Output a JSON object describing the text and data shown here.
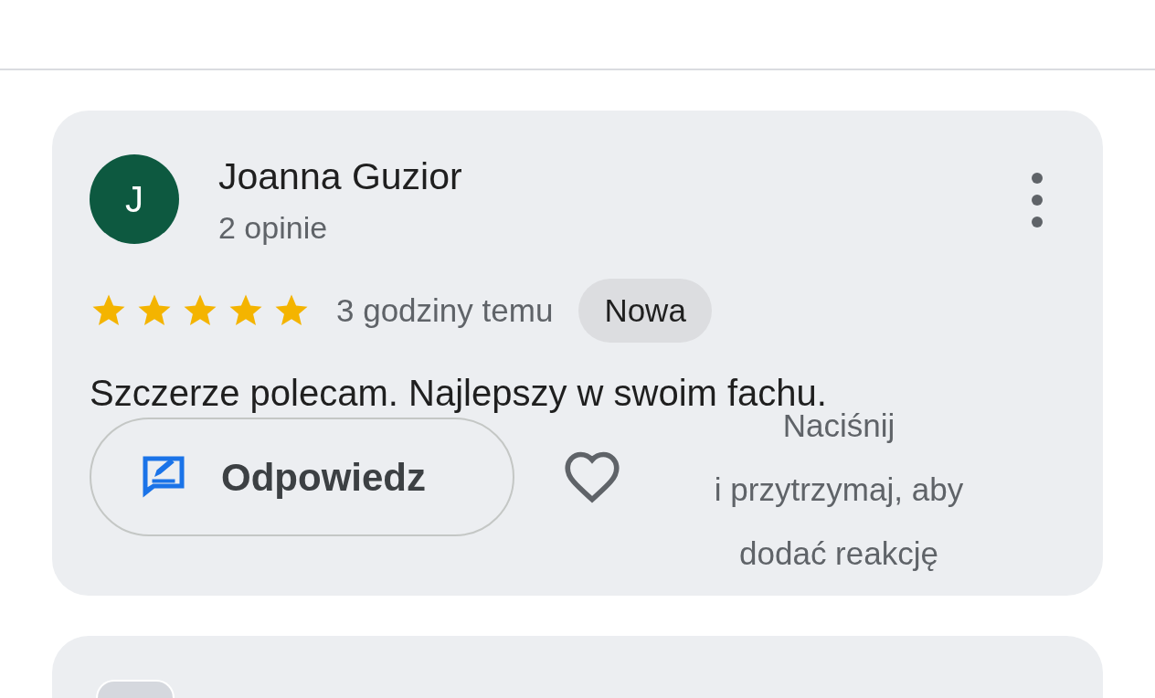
{
  "reviews": [
    {
      "avatar_letter": "J",
      "name": "Joanna Guzior",
      "review_count": "2 opinie",
      "stars": 5,
      "time": "3 godziny temu",
      "badge": "Nowa",
      "text": "Szczerze polecam. Najlepszy w swoim fachu.",
      "reply_button": "Odpowiedz",
      "liked": false,
      "reaction_hint": "Naciśnij\ni przytrzymaj, aby\ndodać reakcję"
    }
  ]
}
